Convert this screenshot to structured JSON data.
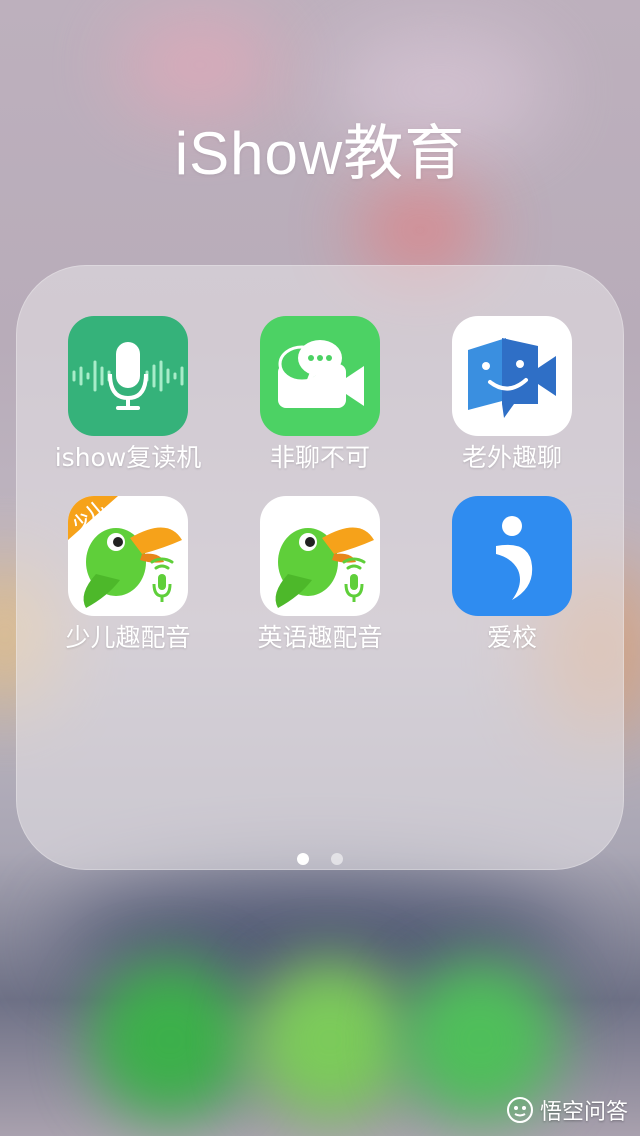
{
  "folder": {
    "title": "iShow教育",
    "apps": [
      {
        "label": "ishow复读机",
        "icon": "microphone-waveform-icon"
      },
      {
        "label": "非聊不可",
        "icon": "chat-video-camera-icon"
      },
      {
        "label": "老外趣聊",
        "icon": "faces-video-camera-icon"
      },
      {
        "label": "少儿趣配音",
        "icon": "parrot-microphone-icon",
        "badge": "少儿"
      },
      {
        "label": "英语趣配音",
        "icon": "parrot-microphone-icon"
      },
      {
        "label": "爱校",
        "icon": "person-swirl-icon"
      }
    ],
    "page_indicator": {
      "pages": 2,
      "current": 1
    }
  },
  "colors": {
    "ishow_green": "#35b27a",
    "feiliao_green": "#4cd264",
    "laowai_blue": "#3a8fe0",
    "aixiao_blue": "#2f8cf0",
    "parrot_green": "#5fcf3a",
    "beak_orange": "#f6a21a"
  },
  "watermark": {
    "text": "悟空问答"
  }
}
